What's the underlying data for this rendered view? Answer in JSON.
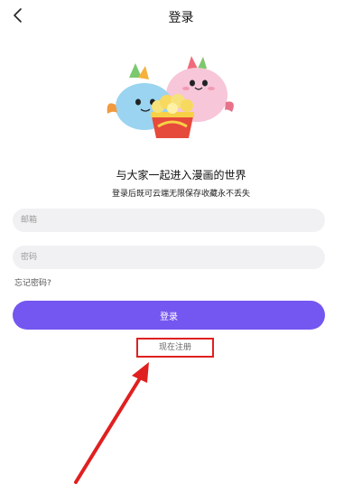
{
  "header": {
    "title": "登录",
    "back_icon": "chevron-left-icon"
  },
  "illustration": {
    "icon": "mascot-popcorn-illustration"
  },
  "intro": {
    "tagline": "与大家一起进入漫画的世界",
    "subline": "登录后既可云端无限保存收藏永不丢失"
  },
  "form": {
    "email_placeholder": "邮箱",
    "password_placeholder": "密码",
    "forgot_label": "忘记密码?",
    "login_label": "登录",
    "register_label": "现在注册"
  },
  "annotation": {
    "highlight_color": "#e02020"
  },
  "colors": {
    "primary": "#7456f0",
    "field_bg": "#f1f1f3"
  }
}
